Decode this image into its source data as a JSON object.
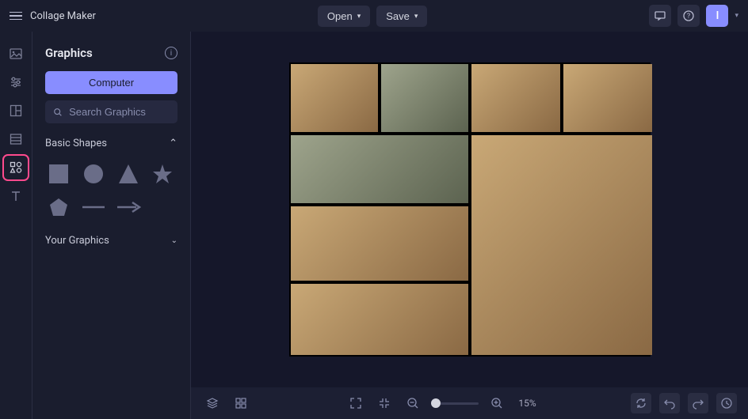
{
  "app": {
    "title": "Collage Maker"
  },
  "header": {
    "open_label": "Open",
    "save_label": "Save",
    "avatar_initial": "I"
  },
  "rail": {
    "items": [
      {
        "name": "image-icon"
      },
      {
        "name": "sliders-icon"
      },
      {
        "name": "layout-icon"
      },
      {
        "name": "table-icon"
      },
      {
        "name": "graphics-icon",
        "active": true
      },
      {
        "name": "text-icon"
      }
    ]
  },
  "panel": {
    "title": "Graphics",
    "computer_label": "Computer",
    "search_placeholder": "Search Graphics",
    "sections": {
      "basic_shapes": "Basic Shapes",
      "your_graphics": "Your Graphics"
    },
    "shapes": [
      "square",
      "circle",
      "triangle",
      "star",
      "pentagon",
      "line",
      "arrow"
    ]
  },
  "bottombar": {
    "zoom_value": "15%"
  }
}
